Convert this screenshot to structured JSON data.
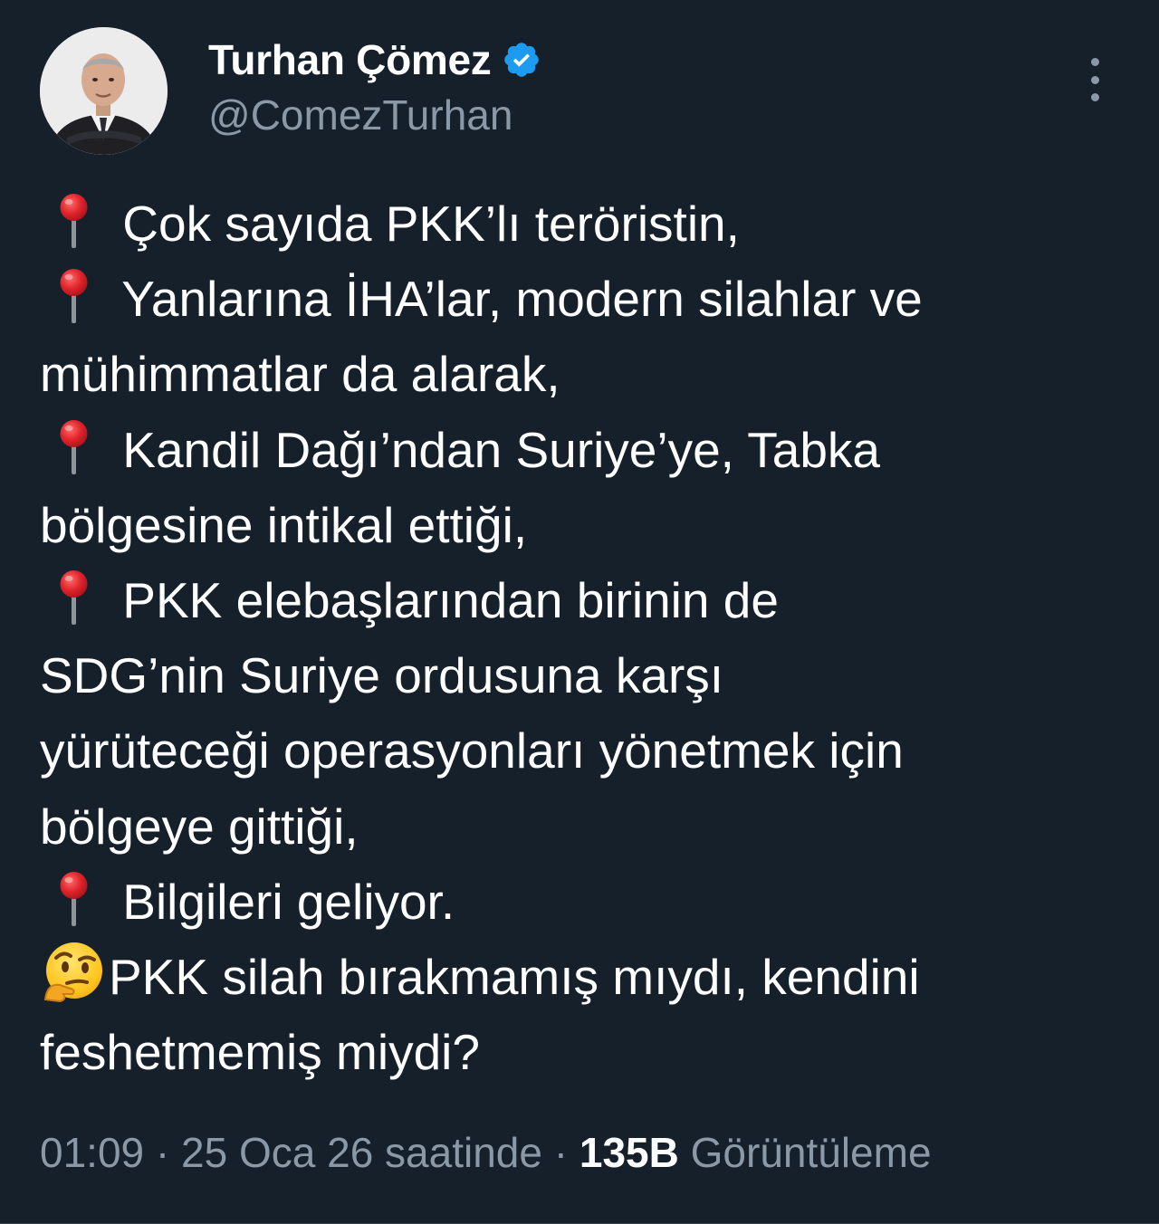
{
  "author": {
    "display_name": "Turhan Çömez",
    "handle": "@ComezTurhan",
    "verified": true
  },
  "icons": {
    "bullet": "round-pushpin-icon",
    "thinking": "thinking-face-icon",
    "verified": "verified-badge-icon",
    "more": "more-options-icon"
  },
  "colors": {
    "background": "#15202b",
    "primary_text": "#ffffff",
    "secondary_text": "#8b98a5",
    "verified_blue": "#1d9bf0",
    "pin_red": "#e0242b"
  },
  "tweet": {
    "lines": [
      {
        "icon": "pin",
        "text": " Çok sayıda PKK’lı teröristin,"
      },
      {
        "icon": "pin",
        "text": " Yanlarına İHA’lar, modern silahlar ve"
      },
      {
        "icon": "",
        "text": "mühimmatlar da alarak,"
      },
      {
        "icon": "pin",
        "text": " Kandil Dağı’ndan Suriye’ye, Tabka"
      },
      {
        "icon": "",
        "text": "bölgesine intikal ettiği,"
      },
      {
        "icon": "pin",
        "text": " PKK elebaşlarından birinin de"
      },
      {
        "icon": "",
        "text": "SDG’nin Suriye ordusuna karşı"
      },
      {
        "icon": "",
        "text": "yürüteceği operasyonları yönetmek için"
      },
      {
        "icon": "",
        "text": "bölgeye gittiği,"
      },
      {
        "icon": "pin",
        "text": " Bilgileri geliyor."
      },
      {
        "icon": "thinking",
        "text": "PKK silah bırakmamış mıydı, kendini"
      },
      {
        "icon": "",
        "text": "feshetmemiş miydi?"
      }
    ]
  },
  "meta": {
    "time": "01:09",
    "separator": " · ",
    "date": "25 Oca 26 saatinde",
    "views_count": "135B",
    "views_label": " Görüntüleme"
  }
}
